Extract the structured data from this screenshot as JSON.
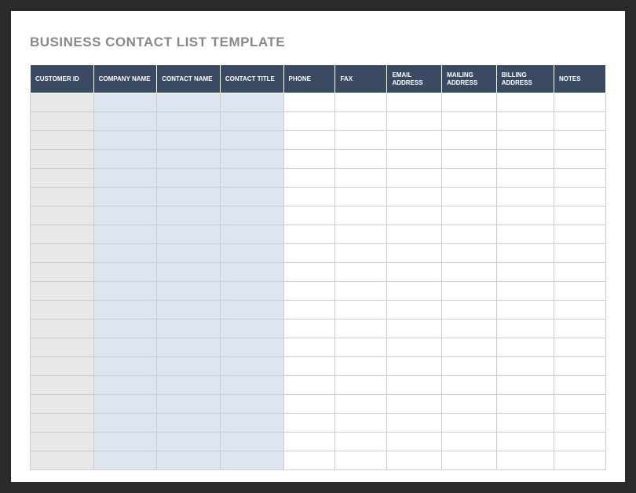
{
  "title": "BUSINESS CONTACT LIST TEMPLATE",
  "table": {
    "columns": [
      "CUSTOMER ID",
      "COMPANY NAME",
      "CONTACT NAME",
      "CONTACT TITLE",
      "PHONE",
      "FAX",
      "EMAIL ADDRESS",
      "MAILING ADDRESS",
      "BILLING ADDRESS",
      "NOTES"
    ],
    "rowCount": 20,
    "rows": [
      [
        "",
        "",
        "",
        "",
        "",
        "",
        "",
        "",
        "",
        ""
      ],
      [
        "",
        "",
        "",
        "",
        "",
        "",
        "",
        "",
        "",
        ""
      ],
      [
        "",
        "",
        "",
        "",
        "",
        "",
        "",
        "",
        "",
        ""
      ],
      [
        "",
        "",
        "",
        "",
        "",
        "",
        "",
        "",
        "",
        ""
      ],
      [
        "",
        "",
        "",
        "",
        "",
        "",
        "",
        "",
        "",
        ""
      ],
      [
        "",
        "",
        "",
        "",
        "",
        "",
        "",
        "",
        "",
        ""
      ],
      [
        "",
        "",
        "",
        "",
        "",
        "",
        "",
        "",
        "",
        ""
      ],
      [
        "",
        "",
        "",
        "",
        "",
        "",
        "",
        "",
        "",
        ""
      ],
      [
        "",
        "",
        "",
        "",
        "",
        "",
        "",
        "",
        "",
        ""
      ],
      [
        "",
        "",
        "",
        "",
        "",
        "",
        "",
        "",
        "",
        ""
      ],
      [
        "",
        "",
        "",
        "",
        "",
        "",
        "",
        "",
        "",
        ""
      ],
      [
        "",
        "",
        "",
        "",
        "",
        "",
        "",
        "",
        "",
        ""
      ],
      [
        "",
        "",
        "",
        "",
        "",
        "",
        "",
        "",
        "",
        ""
      ],
      [
        "",
        "",
        "",
        "",
        "",
        "",
        "",
        "",
        "",
        ""
      ],
      [
        "",
        "",
        "",
        "",
        "",
        "",
        "",
        "",
        "",
        ""
      ],
      [
        "",
        "",
        "",
        "",
        "",
        "",
        "",
        "",
        "",
        ""
      ],
      [
        "",
        "",
        "",
        "",
        "",
        "",
        "",
        "",
        "",
        ""
      ],
      [
        "",
        "",
        "",
        "",
        "",
        "",
        "",
        "",
        "",
        ""
      ],
      [
        "",
        "",
        "",
        "",
        "",
        "",
        "",
        "",
        "",
        ""
      ],
      [
        "",
        "",
        "",
        "",
        "",
        "",
        "",
        "",
        "",
        ""
      ]
    ]
  },
  "colors": {
    "headerBg": "#3a4a63",
    "idColBg": "#e8e8e8",
    "blueColBg": "#dce5f0",
    "whiteColBg": "#ffffff",
    "border": "#cccccc",
    "titleColor": "#888888"
  }
}
